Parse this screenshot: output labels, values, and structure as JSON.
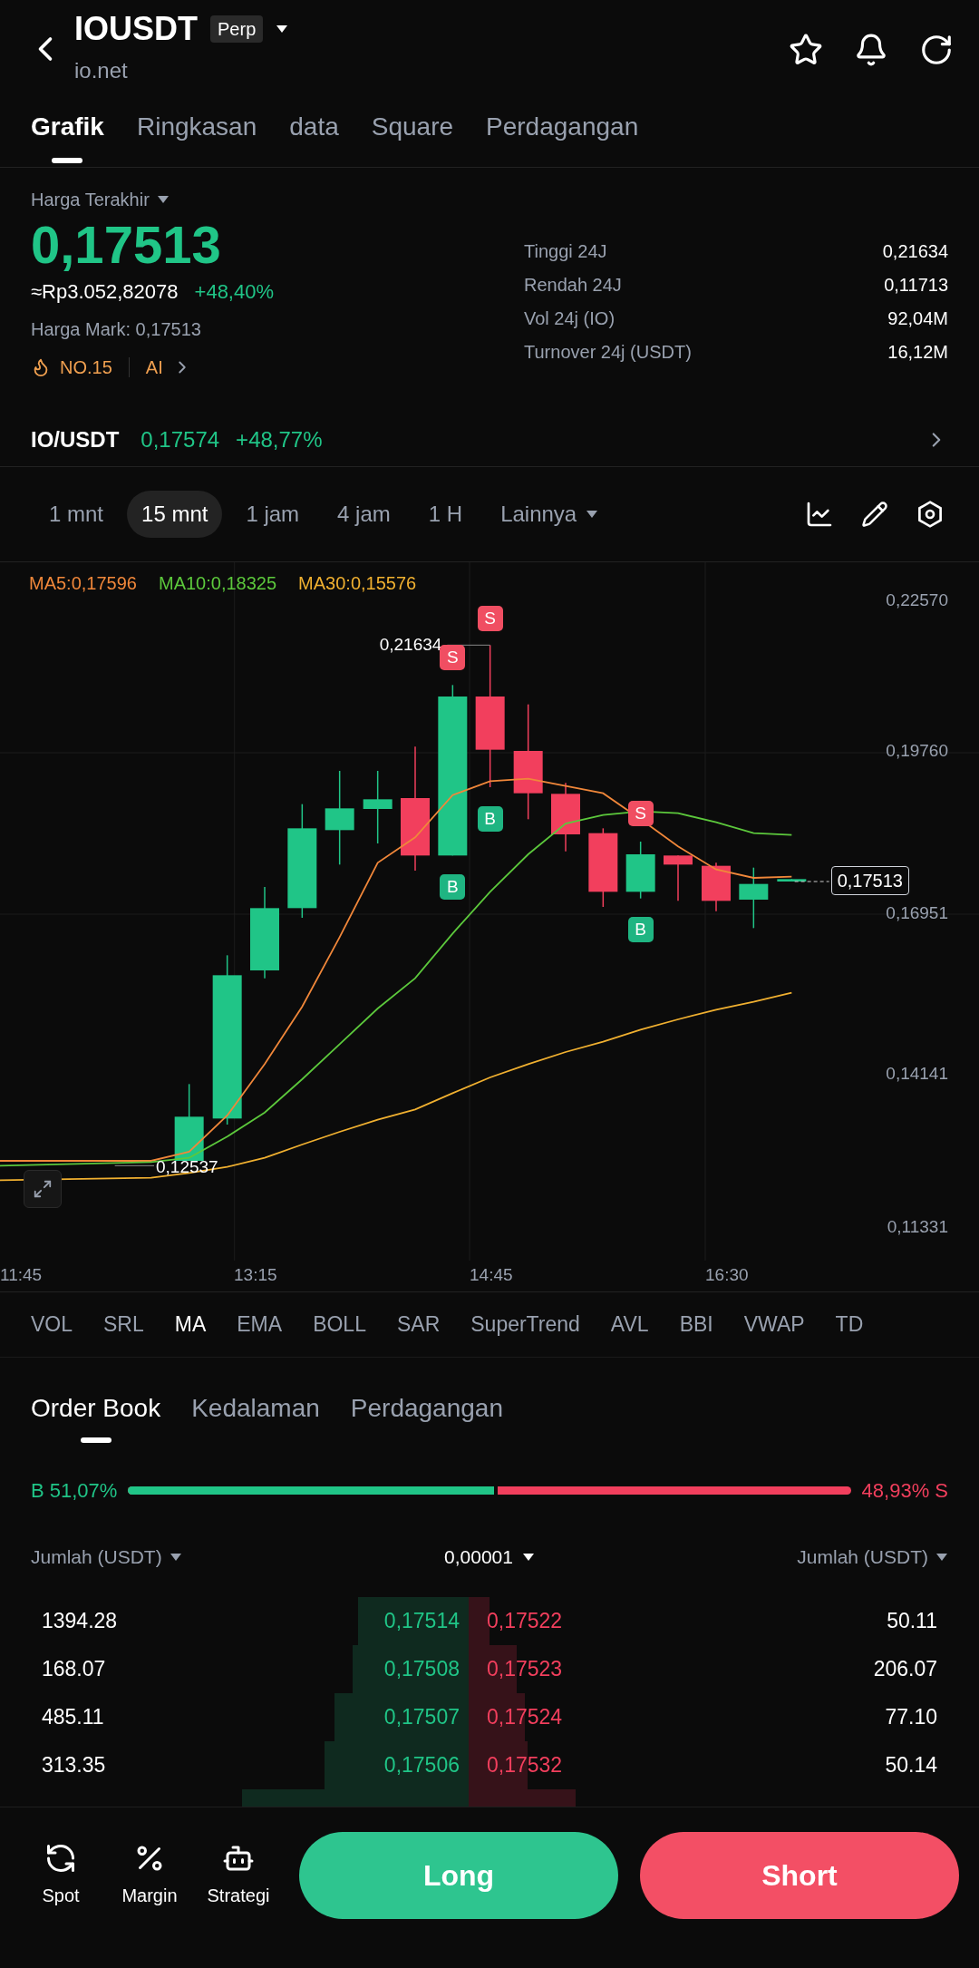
{
  "header": {
    "symbol": "IOUSDT",
    "badge": "Perp",
    "subtitle": "io.net"
  },
  "tabs": [
    {
      "label": "Grafik",
      "selected": true
    },
    {
      "label": "Ringkasan",
      "selected": false
    },
    {
      "label": "data",
      "selected": false
    },
    {
      "label": "Square",
      "selected": false
    },
    {
      "label": "Perdagangan",
      "selected": false
    }
  ],
  "price": {
    "label": "Harga Terakhir",
    "last": "0,17513",
    "fiat": "≈Rp3.052,82078",
    "change": "+48,40%",
    "mark": "Harga Mark: 0,17513",
    "rank": "NO.15",
    "ai": "AI"
  },
  "stats": [
    {
      "label": "Tinggi 24J",
      "value": "0,21634"
    },
    {
      "label": "Rendah 24J",
      "value": "0,11713"
    },
    {
      "label": "Vol 24j (IO)",
      "value": "92,04M"
    },
    {
      "label": "Turnover 24j (USDT)",
      "value": "16,12M"
    }
  ],
  "spot_pair": {
    "symbol": "IO/USDT",
    "price": "0,17574",
    "change": "+48,77%"
  },
  "timeframes": [
    {
      "label": "1 mnt",
      "selected": false
    },
    {
      "label": "15 mnt",
      "selected": true
    },
    {
      "label": "1 jam",
      "selected": false
    },
    {
      "label": "4 jam",
      "selected": false
    },
    {
      "label": "1 H",
      "selected": false
    }
  ],
  "more": "Lainnya",
  "chart": {
    "legend": [
      {
        "label": "MA5:0,17596",
        "color": "#f0873a"
      },
      {
        "label": "MA10:0,18325",
        "color": "#5cc83c"
      },
      {
        "label": "MA30:0,15576",
        "color": "#f0b030"
      }
    ],
    "y_axis": [
      "0,22570",
      "0,19760",
      "0,16951",
      "0,14141",
      "0,11331"
    ],
    "x_axis": [
      "11:45",
      "13:15",
      "14:45",
      "16:30"
    ],
    "high_label": "0,21634",
    "low_label": "0,12537",
    "current_price": "0,17513",
    "markers": [
      {
        "kind": "sell",
        "label": "S"
      },
      {
        "kind": "sell",
        "label": "S"
      },
      {
        "kind": "buy",
        "label": "B"
      },
      {
        "kind": "buy",
        "label": "B"
      },
      {
        "kind": "sell",
        "label": "S"
      },
      {
        "kind": "buy",
        "label": "B"
      }
    ]
  },
  "indicators": [
    {
      "label": "VOL",
      "selected": false
    },
    {
      "label": "SRL",
      "selected": false
    },
    {
      "label": "MA",
      "selected": true
    },
    {
      "label": "EMA",
      "selected": false
    },
    {
      "label": "BOLL",
      "selected": false
    },
    {
      "label": "SAR",
      "selected": false
    },
    {
      "label": "SuperTrend",
      "selected": false
    },
    {
      "label": "AVL",
      "selected": false
    },
    {
      "label": "BBI",
      "selected": false
    },
    {
      "label": "VWAP",
      "selected": false
    },
    {
      "label": "TD",
      "selected": false
    }
  ],
  "order_book": {
    "tabs": [
      {
        "label": "Order Book",
        "selected": true
      },
      {
        "label": "Kedalaman",
        "selected": false
      },
      {
        "label": "Perdagangan",
        "selected": false
      }
    ],
    "buy_ratio": "B 51,07%",
    "sell_ratio": "48,93% S",
    "level": 0.5107,
    "columns": [
      "Jumlah (USDT)",
      "0,00001",
      "Jumlah (USDT)"
    ],
    "rows": [
      {
        "bid": {
          "amount": "1394.28",
          "price": "0,17514"
        },
        "ask": {
          "price": "0,17522",
          "amount": "50.11"
        }
      },
      {
        "bid": {
          "amount": "168.07",
          "price": "0,17508"
        },
        "ask": {
          "price": "0,17523",
          "amount": "206.07"
        }
      },
      {
        "bid": {
          "amount": "485.11",
          "price": "0,17507"
        },
        "ask": {
          "price": "0,17524",
          "amount": "77.10"
        }
      },
      {
        "bid": {
          "amount": "313.35",
          "price": "0,17506"
        },
        "ask": {
          "price": "0,17532",
          "amount": "50.14"
        }
      }
    ]
  },
  "bottom_nav": [
    {
      "label": "Spot",
      "kind": "spot"
    },
    {
      "label": "Margin",
      "kind": "margin"
    },
    {
      "label": "Strategi",
      "kind": "strategy"
    }
  ],
  "actions": [
    {
      "label": "Long",
      "kind": "long"
    },
    {
      "label": "Short",
      "kind": "short"
    }
  ]
}
